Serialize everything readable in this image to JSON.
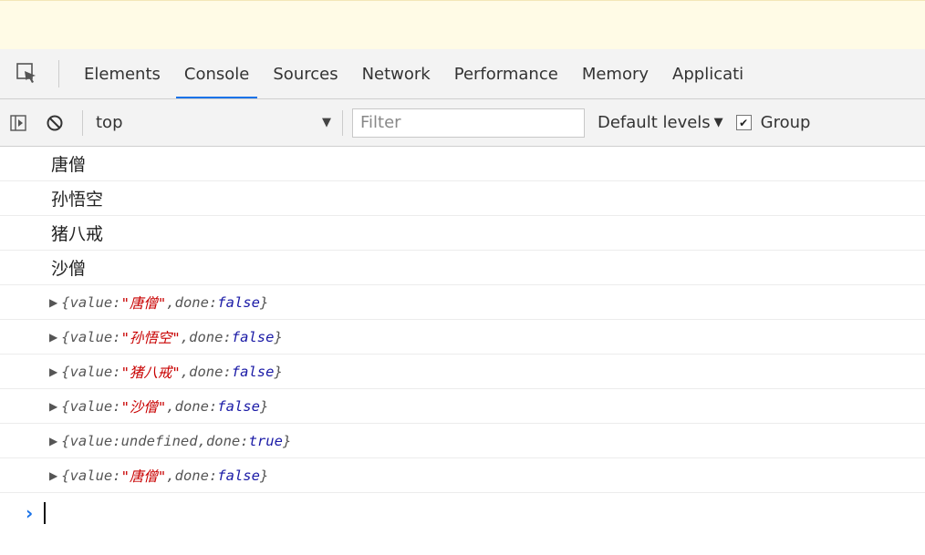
{
  "devtools": {
    "tabs": [
      "Elements",
      "Console",
      "Sources",
      "Network",
      "Performance",
      "Memory",
      "Applicati"
    ],
    "active_tab": "Console",
    "accent_color": "#1a73e8"
  },
  "toolbar": {
    "context": "top",
    "filter_placeholder": "Filter",
    "levels_label": "Default levels",
    "group_label": "Group",
    "group_checked": true
  },
  "console": {
    "logs": [
      "唐僧",
      "孙悟空",
      "猪八戒",
      "沙僧"
    ],
    "objects": [
      {
        "value_key": "value",
        "value": "\"唐僧\"",
        "done_key": "done",
        "done": "false"
      },
      {
        "value_key": "value",
        "value": "\"孙悟空\"",
        "done_key": "done",
        "done": "false"
      },
      {
        "value_key": "value",
        "value": "\"猪八戒\"",
        "done_key": "done",
        "done": "false"
      },
      {
        "value_key": "value",
        "value": "\"沙僧\"",
        "done_key": "done",
        "done": "false"
      },
      {
        "value_key": "value",
        "value": "undefined",
        "done_key": "done",
        "done": "true"
      },
      {
        "value_key": "value",
        "value": "\"唐僧\"",
        "done_key": "done",
        "done": "false"
      }
    ]
  }
}
